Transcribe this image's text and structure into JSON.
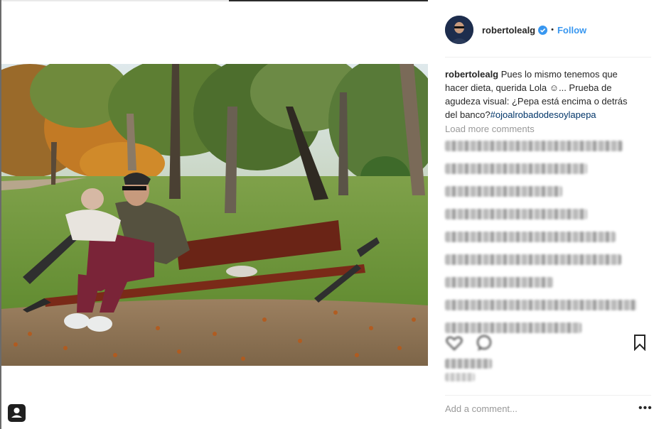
{
  "post": {
    "username": "robertolealg",
    "verified": true,
    "separator": "•",
    "follow_label": "Follow",
    "caption": {
      "username": "robertolealg",
      "text": "Pues lo mismo tenemos que hacer dieta, querida Lola ☺... Prueba de agudeza visual: ¿Pepa está encima o detrás del banco?",
      "hashtag": "#ojoalrobadodesoylapepa"
    },
    "load_more_label": "Load more comments",
    "add_comment_placeholder": "Add a comment...",
    "more_options": "•••"
  },
  "icons": {
    "verified": "verified-badge-icon",
    "heart": "heart-icon",
    "comment": "comment-icon",
    "bookmark": "bookmark-icon",
    "user_tag": "user-tag-icon",
    "more": "more-options-icon"
  },
  "colors": {
    "link_blue": "#3897f0",
    "hashtag": "#003569",
    "muted": "#999999",
    "text": "#262626"
  }
}
